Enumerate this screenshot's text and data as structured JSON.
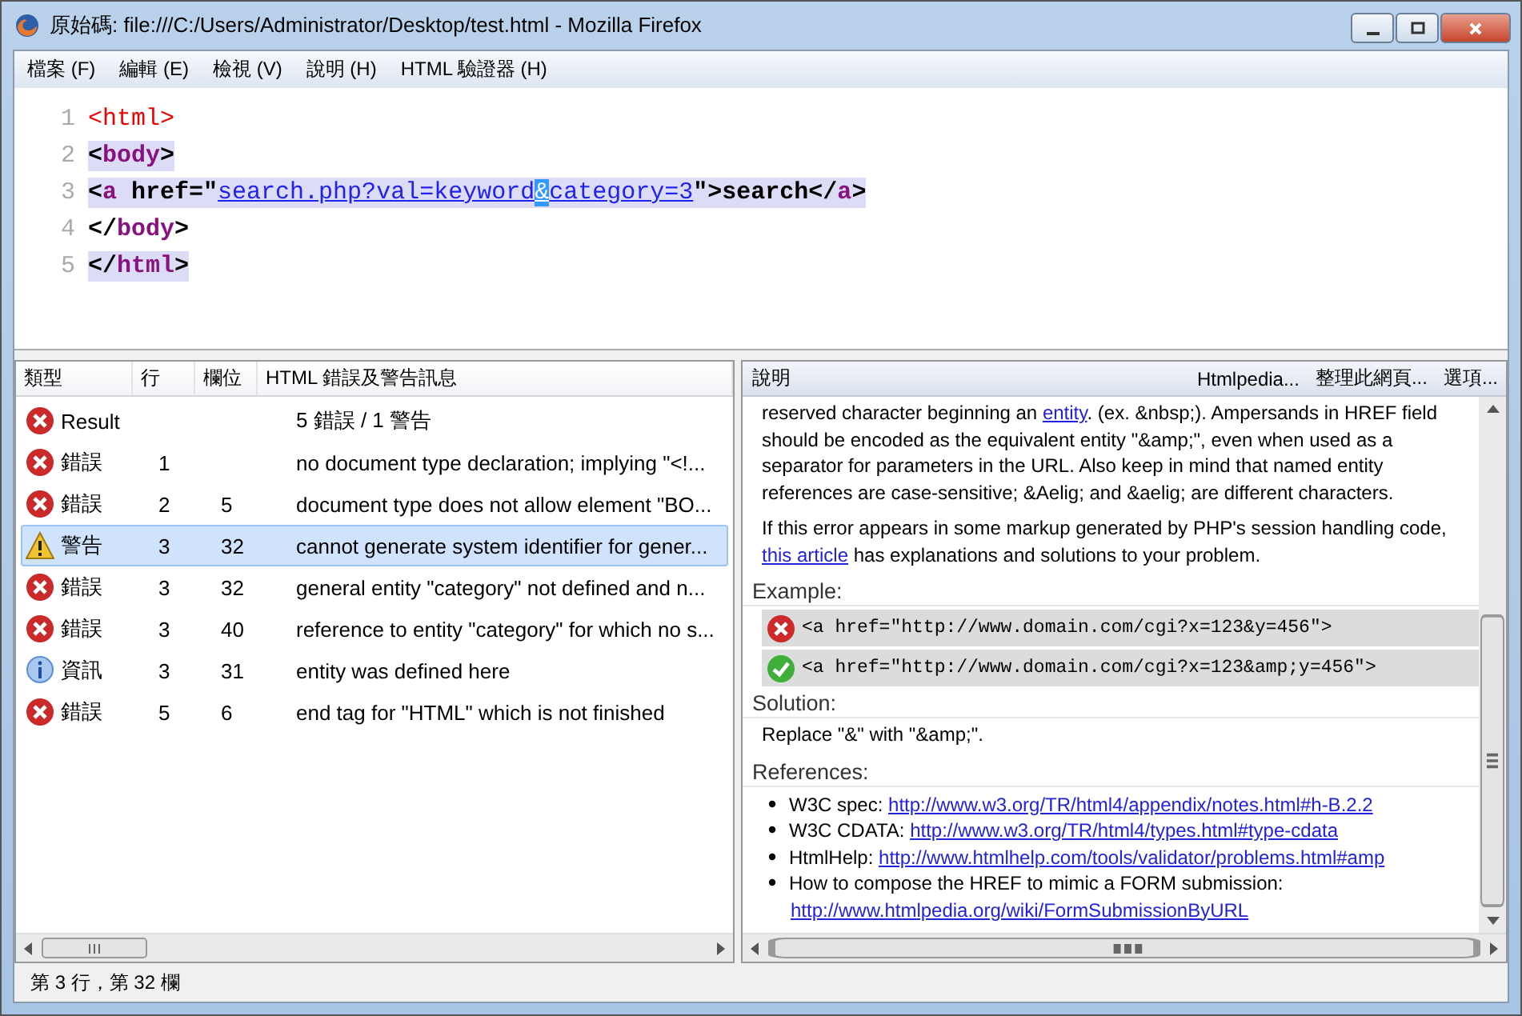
{
  "window": {
    "title": "原始碼: file:///C:/Users/Administrator/Desktop/test.html - Mozilla Firefox"
  },
  "menu": [
    "檔案 (F)",
    "編輯 (E)",
    "檢視 (V)",
    "說明 (H)",
    "HTML 驗證器 (H)"
  ],
  "source": {
    "lines": [
      {
        "number": "1",
        "highlighted": false,
        "tokens": [
          {
            "kind": "error",
            "text": "<html>"
          }
        ]
      },
      {
        "number": "2",
        "highlighted": true,
        "tokens": [
          {
            "kind": "punct",
            "text": "<"
          },
          {
            "kind": "tag",
            "text": "body"
          },
          {
            "kind": "punct",
            "text": ">"
          }
        ]
      },
      {
        "number": "3",
        "highlighted": true,
        "tokens": [
          {
            "kind": "punct",
            "text": "<"
          },
          {
            "kind": "tag",
            "text": "a"
          },
          {
            "kind": "attr",
            "text": " href=\""
          },
          {
            "kind": "value",
            "text": "search.php?val=keyword"
          },
          {
            "kind": "selected",
            "text": "&"
          },
          {
            "kind": "value",
            "text": "category=3"
          },
          {
            "kind": "punct",
            "text": "\">"
          },
          {
            "kind": "bold",
            "text": "search"
          },
          {
            "kind": "punct",
            "text": "</"
          },
          {
            "kind": "tag",
            "text": "a"
          },
          {
            "kind": "punct",
            "text": ">"
          }
        ]
      },
      {
        "number": "4",
        "highlighted": false,
        "tokens": [
          {
            "kind": "punct",
            "text": "</"
          },
          {
            "kind": "tag",
            "text": "body"
          },
          {
            "kind": "punct",
            "text": ">"
          }
        ]
      },
      {
        "number": "5",
        "highlighted": true,
        "tokens": [
          {
            "kind": "punct",
            "text": "</"
          },
          {
            "kind": "tag",
            "text": "html"
          },
          {
            "kind": "punct",
            "text": ">"
          }
        ]
      }
    ]
  },
  "messages": {
    "columns": [
      "類型",
      "行",
      "欄位",
      "HTML 錯誤及警告訊息"
    ],
    "rows": [
      {
        "kind": "error",
        "type": "Result",
        "line": "",
        "column": "",
        "message": "5 錯誤 / 1 警告",
        "selected": false
      },
      {
        "kind": "error",
        "type": "錯誤",
        "line": "1",
        "column": "",
        "message": "no document type declaration; implying \"<!...",
        "selected": false
      },
      {
        "kind": "error",
        "type": "錯誤",
        "line": "2",
        "column": "5",
        "message": "document type does not allow element \"BO...",
        "selected": false
      },
      {
        "kind": "warning",
        "type": "警告",
        "line": "3",
        "column": "32",
        "message": "cannot generate system identifier for gener...",
        "selected": true
      },
      {
        "kind": "error",
        "type": "錯誤",
        "line": "3",
        "column": "32",
        "message": "general entity \"category\" not defined and n...",
        "selected": false
      },
      {
        "kind": "error",
        "type": "錯誤",
        "line": "3",
        "column": "40",
        "message": "reference to entity \"category\" for which no s...",
        "selected": false
      },
      {
        "kind": "info",
        "type": "資訊",
        "line": "3",
        "column": "31",
        "message": "entity was defined here",
        "selected": false
      },
      {
        "kind": "error",
        "type": "錯誤",
        "line": "5",
        "column": "6",
        "message": "end tag for \"HTML\" which is not finished",
        "selected": false
      }
    ]
  },
  "help": {
    "title": "說明",
    "buttons": [
      "Htmlpedia...",
      "整理此網頁...",
      "選項..."
    ],
    "paragraphs": [
      {
        "before": "reserved character beginning an ",
        "link": "entity",
        "after": ". (ex. &nbsp;). Ampersands in HREF field should be encoded as the equivalent entity \"&amp;\", even when used as a separator for parameters in the URL. Also keep in mind that named entity references are case-sensitive; &Aelig; and &aelig; are different characters."
      },
      {
        "before": "If this error appears in some markup generated by PHP's session handling code, ",
        "link": "this article",
        "after": " has explanations and solutions to your problem."
      }
    ],
    "example_heading": "Example:",
    "examples": [
      {
        "kind": "bad",
        "code": "<a href=\"http://www.domain.com/cgi?x=123&y=456\">"
      },
      {
        "kind": "good",
        "code": "<a href=\"http://www.domain.com/cgi?x=123&amp;y=456\">"
      }
    ],
    "solution_heading": "Solution:",
    "solution": "Replace \"&\" with \"&amp;\".",
    "references_heading": "References:",
    "references": [
      {
        "label": "W3C spec: ",
        "url": "http://www.w3.org/TR/html4/appendix/notes.html#h-B.2.2"
      },
      {
        "label": "W3C CDATA: ",
        "url": "http://www.w3.org/TR/html4/types.html#type-cdata"
      },
      {
        "label": "HtmlHelp: ",
        "url": "http://www.htmlhelp.com/tools/validator/problems.html#amp"
      },
      {
        "label": "How to compose the HREF to mimic a FORM submission: ",
        "url": "http://www.htmlpedia.org/wiki/FormSubmissionByURL"
      }
    ]
  },
  "status_bar": "第 3 行，第 32 欄"
}
